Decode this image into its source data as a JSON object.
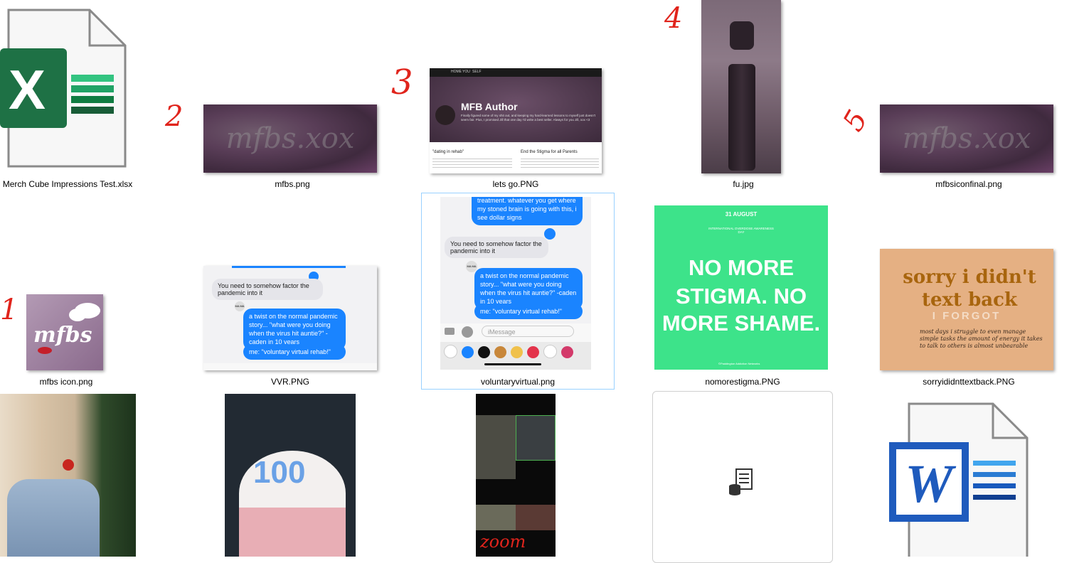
{
  "files": [
    {
      "name": "Merch Cube Impressions Test.xlsx"
    },
    {
      "name": "mfbs.png"
    },
    {
      "name": "lets go.PNG"
    },
    {
      "name": "fu.jpg"
    },
    {
      "name": "mfbsiconfinal.png"
    },
    {
      "name": "mfbs icon.png"
    },
    {
      "name": "VVR.PNG"
    },
    {
      "name": "voluntaryvirtual.png"
    },
    {
      "name": "nomorestigma.PNG"
    },
    {
      "name": "sorryididnttextback.PNG"
    }
  ],
  "annotations": [
    "1",
    "2",
    "3",
    "4",
    "5"
  ],
  "letsgo": {
    "nav": [
      "HOME",
      "YOU",
      "SELF"
    ],
    "title": "MFB Author",
    "bio": "Finally figured some of my shit out, and keeping my hard-learned lessons to myself just doesn't seem fair. Plus, I promised Jill that one day I'd write a best seller. Always for you Jill, xox <3",
    "post1_title": "\"dating in rehab\"",
    "post2_title": "End the Stigma for all Parents"
  },
  "chat": {
    "gray1": "You need to somehow factor the pandemic into it",
    "blue1": "a twist on the normal pandemic story... \"what were you doing when the virus hit auntie?\" -caden in 10 years",
    "blue2": "me: \"voluntary virtual rehab!\"",
    "top_blue": "treatment. whatever you get where my stoned brain is going with this, i see dollar signs",
    "imessage_placeholder": "iMessage",
    "avatar": "MA MA"
  },
  "nomorestigma": {
    "date": "31 AUGUST",
    "sub": "INTERNATIONAL OVERDOSE AWARENESS DAY",
    "line1": "NO MORE",
    "line2": "STIGMA. NO",
    "line3": "MORE SHAME.",
    "credit": "©Paddington Addiction Networks"
  },
  "sorry": {
    "title": "sorry i didn't text back",
    "forgot": "I FORGOT",
    "hand": "most days i struggle to even manage simple tasks the amount of energy it takes to talk to others is almost unbearable"
  },
  "mfbs_logo": "mfbs",
  "watermark": "mfbs.xox",
  "zoom_text": "zoom",
  "cake_text": "100",
  "colors": {
    "selection_border": "#99d1ff",
    "annotation": "#e0241c",
    "excel": "#1e7145",
    "word": "#1f5bbd"
  }
}
